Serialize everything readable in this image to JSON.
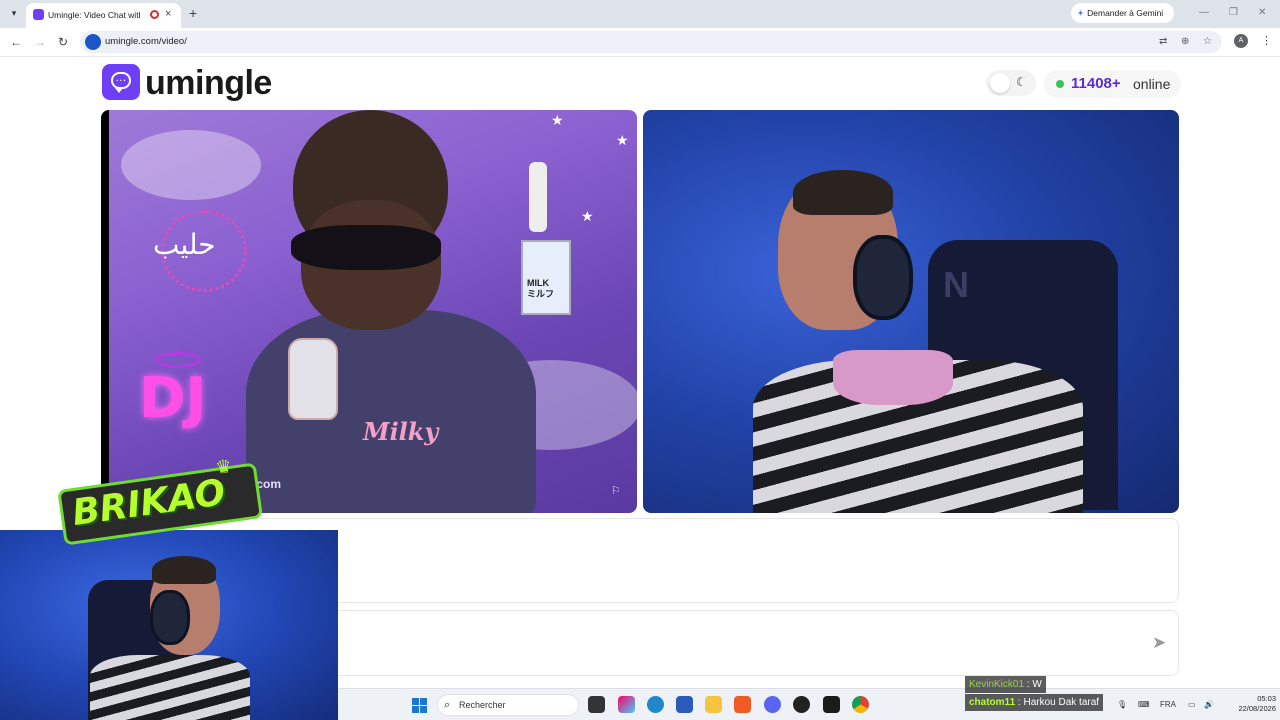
{
  "browser": {
    "tab_title": "Umingle: Video Chat with St",
    "new_tab": "+",
    "gemini_label": "Demander à Gemini",
    "url": "umingle.com/video/"
  },
  "header": {
    "logo_text": "umingle",
    "online_count": "11408+",
    "online_label": "online"
  },
  "left_video": {
    "overlay_texts": [
      "MILK",
      "ミルフ",
      "DJ",
      "Milky",
      ".com"
    ]
  },
  "chat": {
    "log_text": "",
    "input_value": ""
  },
  "stream_overlay": {
    "badge_text": "BRIKAO",
    "chat_lines": [
      {
        "user": "KevinKick01",
        "message": "W"
      },
      {
        "user": "chatom11",
        "message": "Harkou Dak taraf"
      }
    ]
  },
  "taskbar": {
    "search_placeholder": "Rechercher",
    "language": "FRA",
    "time": "05:03",
    "date": "22/08/2026"
  },
  "colors": {
    "brand": "#6f3ff5",
    "online_dot": "#3ac25a",
    "count": "#5b2bd8"
  }
}
